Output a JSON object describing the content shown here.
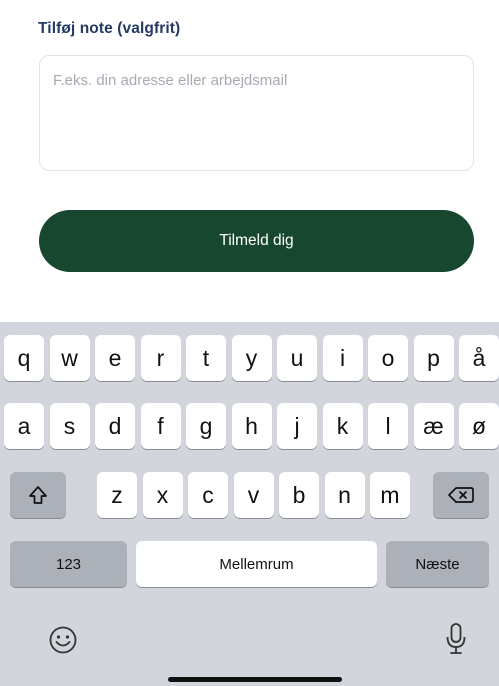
{
  "form": {
    "note_label": "Tilføj note (valgfrit)",
    "note_placeholder": "F.eks. din adresse eller arbejdsmail",
    "note_value": "",
    "submit_label": "Tilmeld dig"
  },
  "keyboard": {
    "row1": [
      "q",
      "w",
      "e",
      "r",
      "t",
      "y",
      "u",
      "i",
      "o",
      "p",
      "å"
    ],
    "row2": [
      "a",
      "s",
      "d",
      "f",
      "g",
      "h",
      "j",
      "k",
      "l",
      "æ",
      "ø"
    ],
    "row3": [
      "z",
      "x",
      "c",
      "v",
      "b",
      "n",
      "m"
    ],
    "numbers_label": "123",
    "space_label": "Mellemrum",
    "next_label": "Næste",
    "icons": {
      "shift": "shift-icon",
      "backspace": "backspace-icon",
      "emoji": "emoji-icon",
      "dictation": "microphone-icon"
    }
  },
  "colors": {
    "button": "#17472e",
    "label": "#243a63",
    "keyboard_bg": "#d2d5db"
  }
}
